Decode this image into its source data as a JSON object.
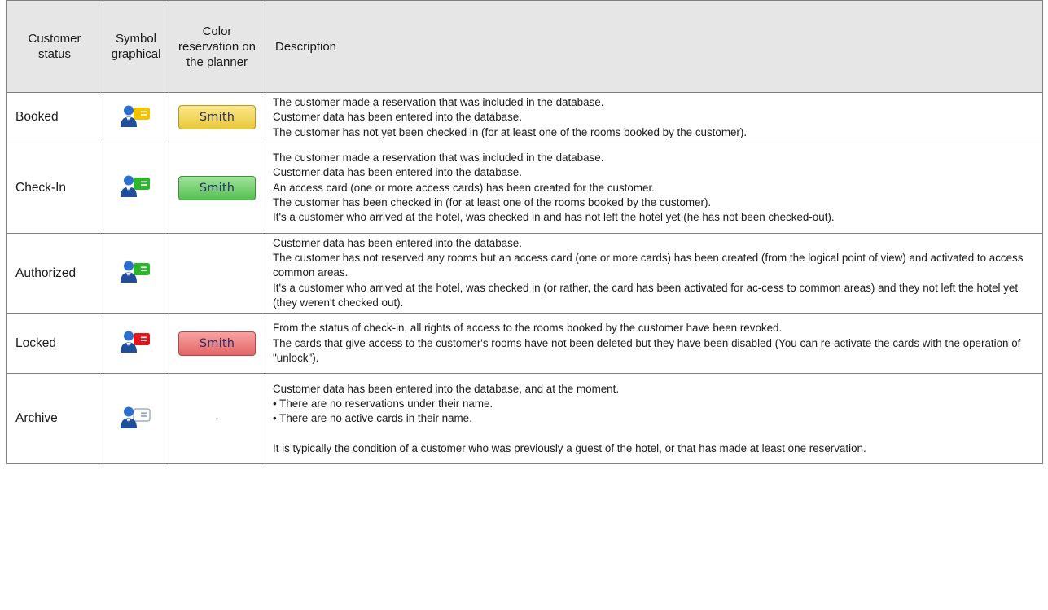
{
  "headers": {
    "status": "Customer\nstatus",
    "symbol": "Symbol\ngraphical",
    "color": "Color\nreservation on\nthe planner",
    "description": "Description"
  },
  "icon_colors": {
    "person_body": "#1f4e9a",
    "person_head": "#2a6fd0",
    "booked": "#f3c300",
    "checkin": "#2db52d",
    "authorized": "#2db52d",
    "locked": "#e0161c",
    "archive": "#ffffff"
  },
  "rows": [
    {
      "status": "Booked",
      "icon": "customer-booked-icon",
      "swatch": "Smith",
      "swatch_color": "#f2d35a",
      "description": [
        "The customer made a reservation that was included in the database.",
        "Customer data has been entered into the database.",
        "The customer has not yet been checked in (for at least one of the rooms booked by the customer)."
      ]
    },
    {
      "status": "Check-In",
      "icon": "customer-checkin-icon",
      "swatch": "Smith",
      "swatch_color": "#7ed178",
      "description": [
        "The customer made a reservation that was included in the database.",
        "Customer data has been entered into the database.",
        "An access card (one or more access cards) has been created for the customer.",
        "The customer has been checked in (for at least one of the rooms booked by the customer).",
        "It's a customer who arrived at the hotel, was checked in and has not left the hotel yet (he has not been checked-out)."
      ]
    },
    {
      "status": "Authorized",
      "icon": "customer-authorized-icon",
      "swatch": "",
      "description": [
        "Customer data has been entered into the database.",
        "The customer has not reserved any rooms but an access card (one or more cards) has been created (from the logical point of view) and activated to access common areas.",
        "It's a customer who arrived at the hotel, was checked in (or rather, the card has been activated for ac-cess to common areas) and they not left the hotel yet (they weren't checked out)."
      ]
    },
    {
      "status": "Locked",
      "icon": "customer-locked-icon",
      "swatch": "Smith",
      "swatch_color": "#ee8585",
      "description": [
        "From the status of check-in, all rights of access to the rooms booked by the customer have been revoked.",
        "The cards that give access to the customer's rooms have not been deleted but they have been disabled (You can re-activate the cards with the operation of \"unlock\")."
      ]
    },
    {
      "status": "Archive",
      "icon": "customer-archive-icon",
      "swatch": "-",
      "description": [
        "Customer data has been entered into the database, and at the moment.",
        "• There are no reservations under their name.",
        "• There are no active cards in their name.",
        "",
        "It is typically the condition of a customer who was previously a guest of the hotel, or that has made at least one reservation."
      ]
    }
  ]
}
